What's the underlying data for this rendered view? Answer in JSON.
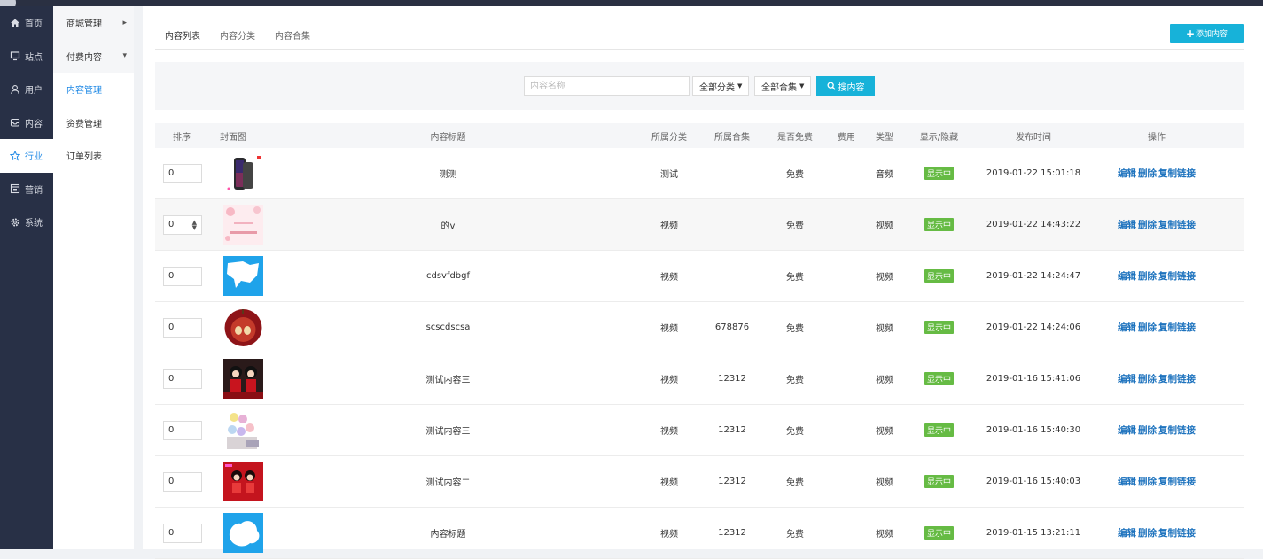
{
  "sidebar": {
    "items": [
      {
        "label": "首页",
        "icon": "home-icon",
        "active": false
      },
      {
        "label": "站点",
        "icon": "monitor-icon",
        "active": false
      },
      {
        "label": "用户",
        "icon": "user-icon",
        "active": false
      },
      {
        "label": "内容",
        "icon": "inbox-icon",
        "active": false
      },
      {
        "label": "行业",
        "icon": "star-icon",
        "active": true
      },
      {
        "label": "营销",
        "icon": "marketing-icon",
        "active": false
      },
      {
        "label": "系统",
        "icon": "gear-icon",
        "active": false
      }
    ]
  },
  "subnav": {
    "items": [
      {
        "label": "商城管理",
        "caret": "▸"
      },
      {
        "label": "付费内容",
        "caret": "▾"
      },
      {
        "label": "内容管理"
      },
      {
        "label": "资费管理"
      },
      {
        "label": "订单列表"
      }
    ]
  },
  "tabs": [
    "内容列表",
    "内容分类",
    "内容合集"
  ],
  "add_button": {
    "label": "添加内容"
  },
  "search": {
    "placeholder": "内容名称",
    "category": "全部分类",
    "collection": "全部合集",
    "button": "搜内容"
  },
  "table": {
    "headers": [
      "排序",
      "封面图",
      "内容标题",
      "所属分类",
      "所属合集",
      "是否免费",
      "费用",
      "类型",
      "显示/隐藏",
      "发布时间",
      "操作"
    ],
    "ops": [
      "编辑",
      "删除",
      "复制链接"
    ],
    "rows": [
      {
        "sort": "0",
        "cover": "phone",
        "title": "测测",
        "category": "测试",
        "collection": "",
        "free": "免费",
        "fee": "",
        "type": "音频",
        "visible": "显示中",
        "time": "2019-01-22 15:01:18"
      },
      {
        "sort": "0",
        "cover": "pink-card",
        "title": "的v",
        "category": "视频",
        "collection": "",
        "free": "免费",
        "fee": "",
        "type": "视频",
        "visible": "显示中",
        "time": "2019-01-22 14:43:22"
      },
      {
        "sort": "0",
        "cover": "blue-map",
        "title": "cdsvfdbgf",
        "category": "视频",
        "collection": "",
        "free": "免费",
        "fee": "",
        "type": "视频",
        "visible": "显示中",
        "time": "2019-01-22 14:24:47"
      },
      {
        "sort": "0",
        "cover": "apple",
        "title": "scscdscsa",
        "category": "视频",
        "collection": "678876",
        "free": "免费",
        "fee": "",
        "type": "视频",
        "visible": "显示中",
        "time": "2019-01-22 14:24:06"
      },
      {
        "sort": "0",
        "cover": "couple-dark",
        "title": "测试内容三",
        "category": "视频",
        "collection": "12312",
        "free": "免费",
        "fee": "",
        "type": "视频",
        "visible": "显示中",
        "time": "2019-01-16 15:41:06"
      },
      {
        "sort": "0",
        "cover": "hearts",
        "title": "测试内容三",
        "category": "视频",
        "collection": "12312",
        "free": "免费",
        "fee": "",
        "type": "视频",
        "visible": "显示中",
        "time": "2019-01-16 15:40:30"
      },
      {
        "sort": "0",
        "cover": "couple-red",
        "title": "测试内容二",
        "category": "视频",
        "collection": "12312",
        "free": "免费",
        "fee": "",
        "type": "视频",
        "visible": "显示中",
        "time": "2019-01-16 15:40:03"
      },
      {
        "sort": "0",
        "cover": "blue-cloud",
        "title": "内容标题",
        "category": "视频",
        "collection": "12312",
        "free": "免费",
        "fee": "",
        "type": "视频",
        "visible": "显示中",
        "time": "2019-01-15 13:21:11"
      }
    ]
  },
  "colors": {
    "accent": "#17b2d9",
    "sidebar": "#283046",
    "link": "#1e73be",
    "badge": "#66bb44"
  }
}
